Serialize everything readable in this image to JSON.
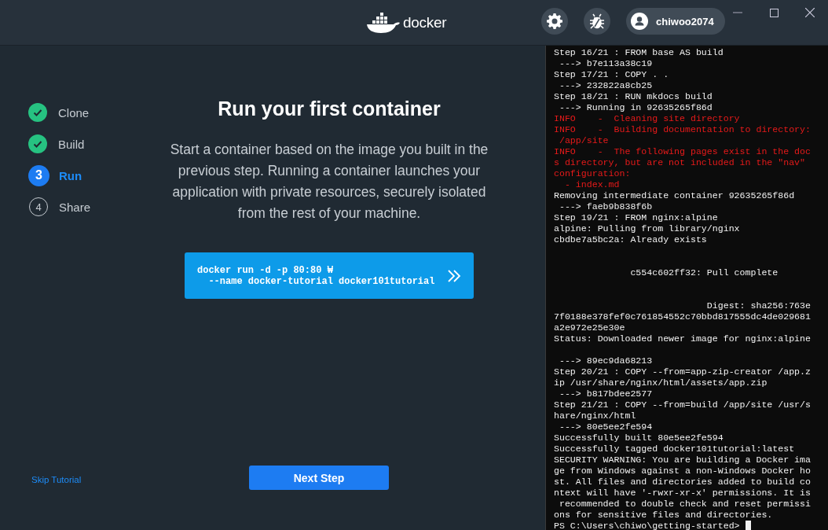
{
  "header": {
    "logo_text": "docker",
    "user": {
      "name": "chiwoo2074"
    }
  },
  "steps": [
    {
      "label": "Clone",
      "kind": "done"
    },
    {
      "label": "Build",
      "kind": "done"
    },
    {
      "label": "Run",
      "kind": "current",
      "number": "3"
    },
    {
      "label": "Share",
      "kind": "pending",
      "number": "4"
    }
  ],
  "main": {
    "title": "Run your first container",
    "description": "Start a container based on the image you built in the previous step. Running a container launches your application with private resources, securely isolated from the rest of your machine.",
    "command_lines": [
      "docker run -d -p 80:80 ₩",
      "  --name docker-tutorial docker101tutorial"
    ],
    "skip_link": "Skip Tutorial",
    "next_button": "Next Step"
  },
  "terminal": {
    "lines": [
      {
        "kind": "normal",
        "text": "Step 16/21 : FROM base AS build"
      },
      {
        "kind": "normal",
        "text": " ---> b7e113a38c19"
      },
      {
        "kind": "normal",
        "text": "Step 17/21 : COPY . ."
      },
      {
        "kind": "normal",
        "text": " ---> 232822a8cb25"
      },
      {
        "kind": "normal",
        "text": "Step 18/21 : RUN mkdocs build"
      },
      {
        "kind": "normal",
        "text": " ---> Running in 92635265f86d"
      },
      {
        "kind": "info",
        "text": "INFO    -  Cleaning site directory"
      },
      {
        "kind": "info",
        "text": "INFO    -  Building documentation to directory:"
      },
      {
        "kind": "info",
        "text": " /app/site"
      },
      {
        "kind": "info",
        "text": "INFO    -  The following pages exist in the doc"
      },
      {
        "kind": "info",
        "text": "s directory, but are not included in the \"nav\""
      },
      {
        "kind": "info",
        "text": "configuration:"
      },
      {
        "kind": "info",
        "text": "  - index.md"
      },
      {
        "kind": "normal",
        "text": "Removing intermediate container 92635265f86d"
      },
      {
        "kind": "normal",
        "text": " ---> faeb9b838f6b"
      },
      {
        "kind": "normal",
        "text": "Step 19/21 : FROM nginx:alpine"
      },
      {
        "kind": "normal",
        "text": "alpine: Pulling from library/nginx"
      },
      {
        "kind": "normal",
        "text": "cbdbe7a5bc2a: Already exists"
      },
      {
        "kind": "blank"
      },
      {
        "kind": "blank"
      },
      {
        "kind": "normal",
        "text": "              c554c602ff32: Pull complete"
      },
      {
        "kind": "blank"
      },
      {
        "kind": "blank"
      },
      {
        "kind": "normal",
        "text": "                            Digest: sha256:763e"
      },
      {
        "kind": "normal",
        "text": "7f0188e378fef0c761854552c70bbd817555dc4de029681"
      },
      {
        "kind": "normal",
        "text": "a2e972e25e30e"
      },
      {
        "kind": "normal",
        "text": "Status: Downloaded newer image for nginx:alpine"
      },
      {
        "kind": "blank"
      },
      {
        "kind": "normal",
        "text": " ---> 89ec9da68213"
      },
      {
        "kind": "normal",
        "text": "Step 20/21 : COPY --from=app-zip-creator /app.z"
      },
      {
        "kind": "normal",
        "text": "ip /usr/share/nginx/html/assets/app.zip"
      },
      {
        "kind": "normal",
        "text": " ---> b817bdee2577"
      },
      {
        "kind": "normal",
        "text": "Step 21/21 : COPY --from=build /app/site /usr/s"
      },
      {
        "kind": "normal",
        "text": "hare/nginx/html"
      },
      {
        "kind": "normal",
        "text": " ---> 80e5ee2fe594"
      },
      {
        "kind": "normal",
        "text": "Successfully built 80e5ee2fe594"
      },
      {
        "kind": "normal",
        "text": "Successfully tagged docker101tutorial:latest"
      },
      {
        "kind": "normal",
        "text": "SECURITY WARNING: You are building a Docker ima"
      },
      {
        "kind": "normal",
        "text": "ge from Windows against a non-Windows Docker ho"
      },
      {
        "kind": "normal",
        "text": "st. All files and directories added to build co"
      },
      {
        "kind": "normal",
        "text": "ntext will have '-rwxr-xr-x' permissions. It is"
      },
      {
        "kind": "normal",
        "text": " recommended to double check and reset permissi"
      },
      {
        "kind": "normal",
        "text": "ons for sensitive files and directories."
      },
      {
        "kind": "prompt",
        "text": "PS C:\\Users\\chiwo\\getting-started> "
      }
    ]
  }
}
